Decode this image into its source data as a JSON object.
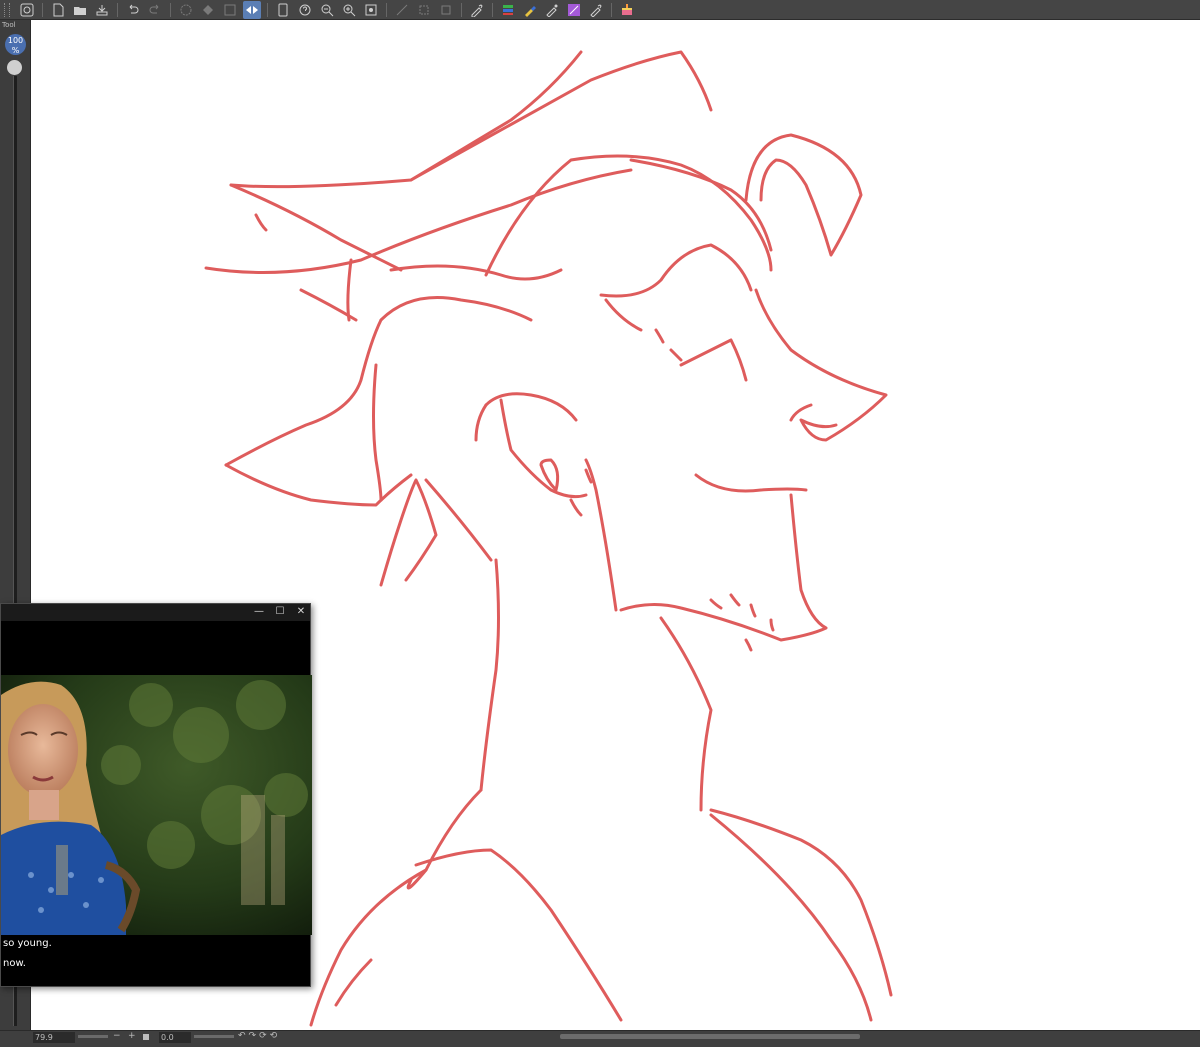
{
  "toolbar": {
    "icons": [
      "file-icon",
      "new-icon",
      "open-icon",
      "save-icon",
      "undo-icon",
      "redo-icon",
      "transform-icon",
      "flip-icon",
      "pen-icon",
      "help-icon",
      "zoom-out-icon",
      "zoom-in-icon",
      "fit-icon",
      "select-icon",
      "eyedropper-icon",
      "layers-icon",
      "brush-icon",
      "color-icon",
      "paint-icon",
      "cake-icon"
    ]
  },
  "left_panel": {
    "tool_label": "Tool",
    "zoom_badge_line1": "100",
    "zoom_badge_line2": "%"
  },
  "canvas": {
    "stroke_color": "#d94040",
    "background": "#ffffff"
  },
  "status_bar": {
    "zoom_value": "79.9",
    "minus_label": "−",
    "plus_label": "+",
    "rotation_value": "0.0",
    "rotate_icons": "↶↷⟳⟲"
  },
  "video_window": {
    "minimize_label": "—",
    "maximize_label": "☐",
    "close_label": "✕",
    "subtitle_line1": "so young.",
    "subtitle_line2": "now."
  }
}
